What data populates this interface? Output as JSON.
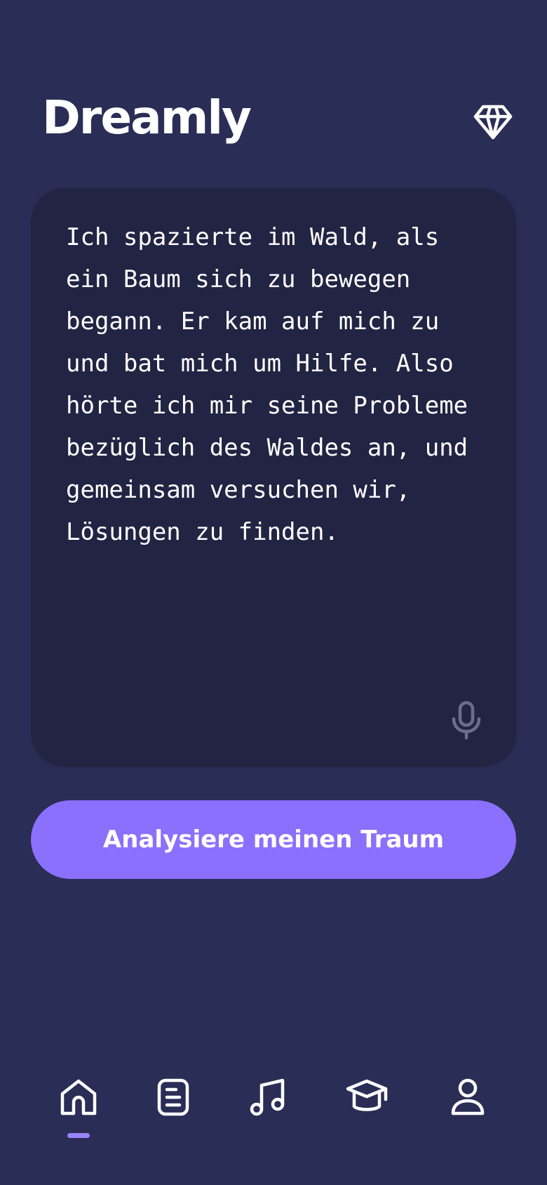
{
  "app": {
    "title": "Dreamly"
  },
  "header": {
    "premium_icon": "diamond-icon"
  },
  "dream_input": {
    "text": "Ich spazierte im Wald, als ein Baum sich zu bewegen begann. Er kam auf mich zu und bat mich um Hilfe. Also hörte ich mir seine Probleme bezüglich des Waldes an, und gemeinsam versuchen wir, Lösungen zu finden.",
    "mic_icon": "microphone-icon"
  },
  "actions": {
    "analyze_label": "Analysiere meinen Traum"
  },
  "nav": {
    "items": [
      {
        "id": "home",
        "icon": "home-icon",
        "active": true
      },
      {
        "id": "journal",
        "icon": "document-icon",
        "active": false
      },
      {
        "id": "music",
        "icon": "music-note-icon",
        "active": false
      },
      {
        "id": "learn",
        "icon": "graduation-cap-icon",
        "active": false
      },
      {
        "id": "profile",
        "icon": "user-icon",
        "active": false
      }
    ]
  },
  "colors": {
    "background": "#2a2d55",
    "card": "#222443",
    "accent": "#8b6ffd",
    "indicator": "#9b82ff",
    "mic": "#6b6d8c"
  }
}
